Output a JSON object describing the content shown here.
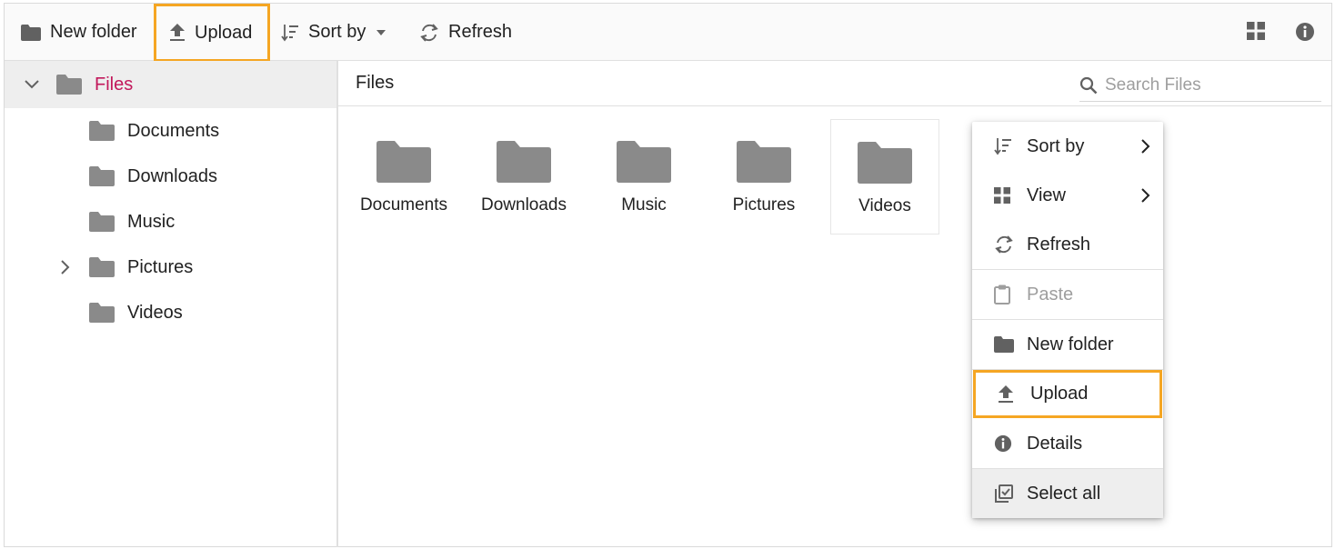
{
  "toolbar": {
    "new_folder_label": "New folder",
    "upload_label": "Upload",
    "sort_by_label": "Sort by",
    "refresh_label": "Refresh",
    "grid_view_icon": "grid-view-icon",
    "details_icon": "info-icon"
  },
  "navigation": {
    "root": {
      "label": "Files",
      "expanded": true
    },
    "folders": [
      {
        "label": "Documents",
        "has_children": false
      },
      {
        "label": "Downloads",
        "has_children": false
      },
      {
        "label": "Music",
        "has_children": false
      },
      {
        "label": "Pictures",
        "has_children": true
      },
      {
        "label": "Videos",
        "has_children": false
      }
    ]
  },
  "content": {
    "breadcrumb": "Files",
    "search_placeholder": "Search Files",
    "items": [
      {
        "label": "Documents",
        "selected": false
      },
      {
        "label": "Downloads",
        "selected": false
      },
      {
        "label": "Music",
        "selected": false
      },
      {
        "label": "Pictures",
        "selected": false
      },
      {
        "label": "Videos",
        "selected": true
      }
    ]
  },
  "context_menu": {
    "items": [
      {
        "label": "Sort by",
        "icon": "sort-icon",
        "submenu": true
      },
      {
        "label": "View",
        "icon": "grid-view-icon",
        "submenu": true
      },
      {
        "label": "Refresh",
        "icon": "refresh-icon"
      },
      {
        "label": "Paste",
        "icon": "clipboard-icon",
        "disabled": true
      },
      {
        "label": "New folder",
        "icon": "folder-icon"
      },
      {
        "label": "Upload",
        "icon": "upload-icon",
        "highlighted": true
      },
      {
        "label": "Details",
        "icon": "info-icon"
      },
      {
        "label": "Select all",
        "icon": "select-all-icon",
        "hovered": true
      }
    ]
  },
  "colors": {
    "accent_highlight": "#f5a623",
    "selected_root_text": "#c2185b",
    "folder_icon": "#8a8a8a",
    "toolbar_bg": "#fafafa"
  }
}
